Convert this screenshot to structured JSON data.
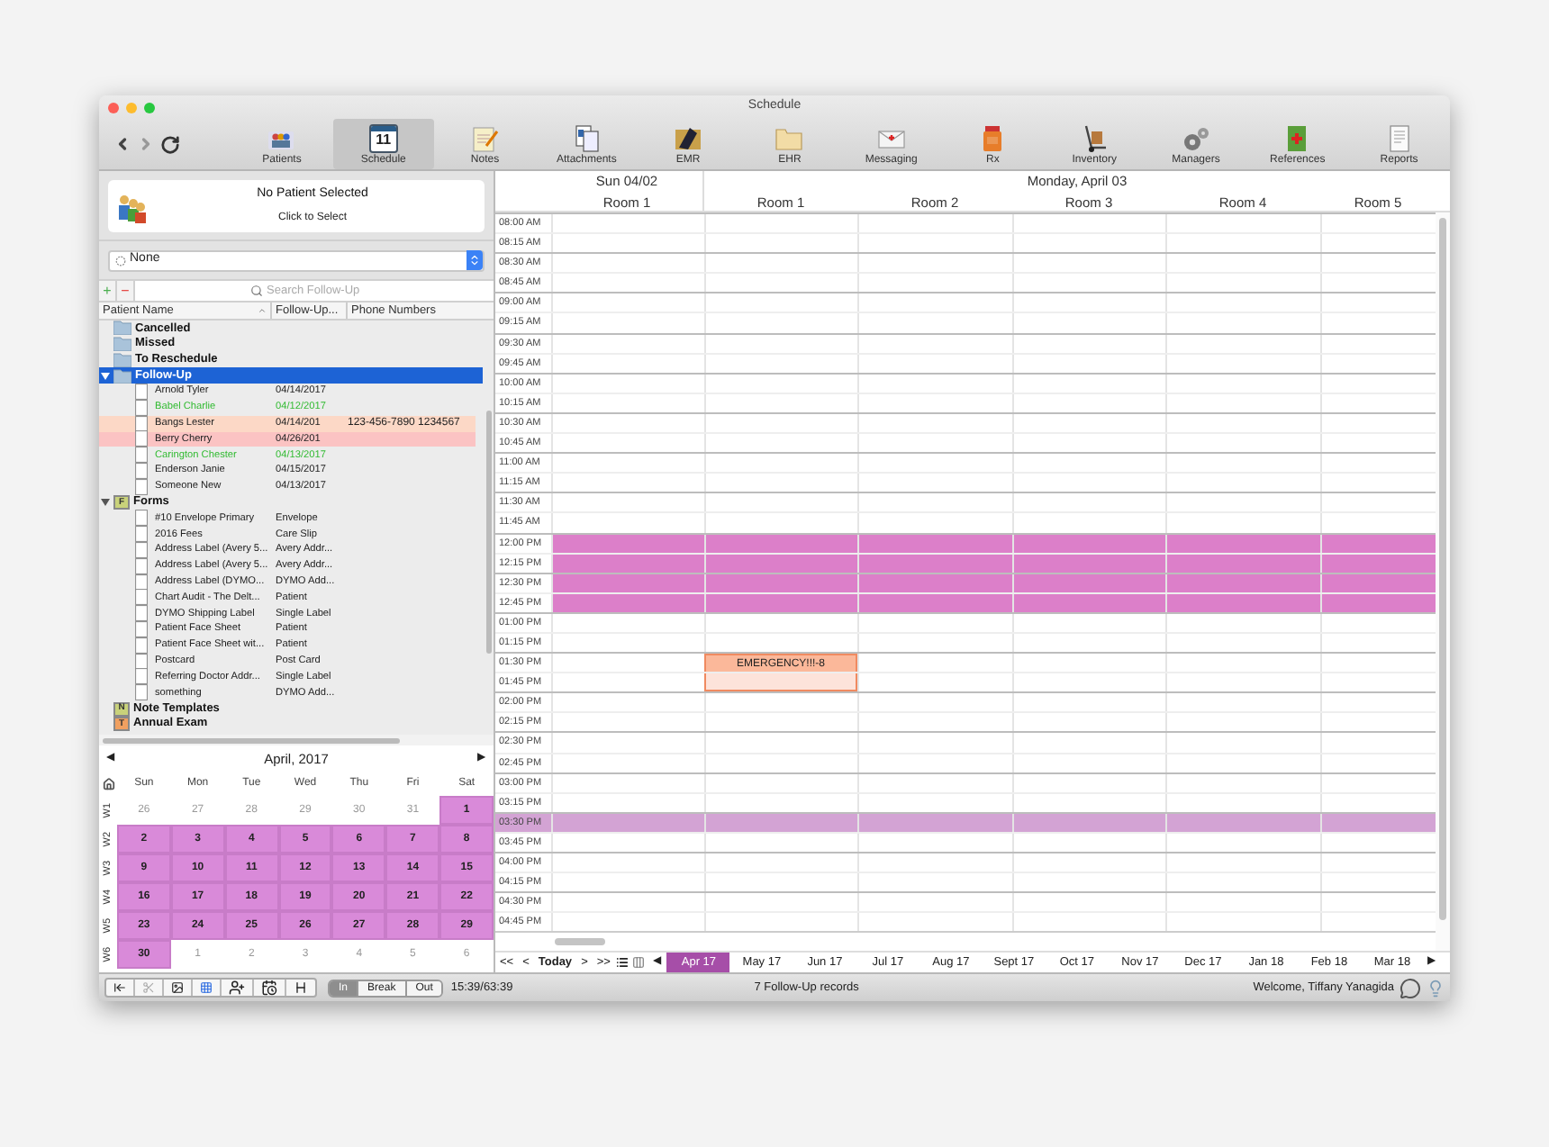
{
  "window": {
    "title": "Schedule"
  },
  "toolbar": {
    "items": [
      {
        "label": "Patients",
        "kind": "patients",
        "selected": false
      },
      {
        "label": "Schedule",
        "kind": "schedule",
        "selected": true,
        "badge": "11"
      },
      {
        "label": "Notes",
        "kind": "notes",
        "selected": false
      },
      {
        "label": "Attachments",
        "kind": "attachments",
        "selected": false
      },
      {
        "label": "EMR",
        "kind": "emr",
        "selected": false
      },
      {
        "label": "EHR",
        "kind": "ehr",
        "selected": false
      },
      {
        "label": "Messaging",
        "kind": "messaging",
        "selected": false
      },
      {
        "label": "Rx",
        "kind": "rx",
        "selected": false
      },
      {
        "label": "Inventory",
        "kind": "inventory",
        "selected": false
      },
      {
        "label": "Managers",
        "kind": "managers",
        "selected": false
      },
      {
        "label": "References",
        "kind": "references",
        "selected": false
      },
      {
        "label": "Reports",
        "kind": "reports",
        "selected": false
      }
    ]
  },
  "patient_card": {
    "title": "No Patient Selected",
    "subtitle": "Click to Select"
  },
  "filter_select": {
    "value": "None"
  },
  "list_toolbar": {
    "add": "+",
    "remove": "−",
    "search_placeholder": "Search Follow-Up"
  },
  "list": {
    "columns": [
      "Patient Name",
      "Follow-Up...",
      "Phone Numbers"
    ],
    "items": [
      {
        "label": "Cancelled",
        "kind": "folder",
        "expanded": false,
        "selected": false
      },
      {
        "label": "Missed",
        "kind": "folder",
        "expanded": false,
        "selected": false
      },
      {
        "label": "To Reschedule",
        "kind": "folder",
        "expanded": false,
        "selected": false
      },
      {
        "label": "Follow-Up",
        "kind": "folder",
        "expanded": true,
        "selected": true,
        "children": [
          {
            "label": "Arnold Tyler",
            "column_2": "04/14/2017",
            "kind": "plain"
          },
          {
            "label": "Babel Charlie",
            "column_2": "04/12/2017",
            "kind": "confirmed"
          },
          {
            "label": "Bangs Lester",
            "column_2": "04/14/201",
            "column_3": "123-456-7890 1234567",
            "kind": "pending"
          },
          {
            "label": "Berry Cherry",
            "column_2": "04/26/201",
            "kind": "overdue"
          },
          {
            "label": "Carington Chester",
            "column_2": "04/13/2017",
            "kind": "confirmed"
          },
          {
            "label": "Enderson Janie",
            "column_2": "04/15/2017",
            "kind": "plain"
          },
          {
            "label": "Someone New",
            "column_2": "04/13/2017",
            "kind": "plain"
          }
        ]
      },
      {
        "label": "Forms",
        "kind": "category",
        "badge": "F",
        "color": "#c9d27a",
        "expanded": true,
        "selected": false,
        "children": [
          {
            "label": "#10 Envelope Primary",
            "column_2": "Envelope",
            "kind": "plain"
          },
          {
            "label": "2016 Fees",
            "column_2": "Care Slip",
            "kind": "plain"
          },
          {
            "label": "Address Label (Avery 5...",
            "column_2": "Avery Addr...",
            "kind": "plain"
          },
          {
            "label": "Address Label (Avery 5...",
            "column_2": "Avery Addr...",
            "kind": "plain"
          },
          {
            "label": "Address Label (DYMO...",
            "column_2": "DYMO Add...",
            "kind": "plain"
          },
          {
            "label": "Chart Audit - The Delt...",
            "column_2": "Patient",
            "kind": "plain"
          },
          {
            "label": "DYMO Shipping Label",
            "column_2": "Single Label",
            "kind": "plain"
          },
          {
            "label": "Patient Face Sheet",
            "column_2": "Patient",
            "kind": "plain"
          },
          {
            "label": "Patient Face Sheet wit...",
            "column_2": "Patient",
            "kind": "plain"
          },
          {
            "label": "Postcard",
            "column_2": "Post Card",
            "kind": "plain"
          },
          {
            "label": "Referring Doctor Addr...",
            "column_2": "Single Label",
            "kind": "plain"
          },
          {
            "label": "something",
            "column_2": "DYMO Add...",
            "kind": "plain"
          }
        ]
      },
      {
        "label": "Note Templates",
        "kind": "category",
        "badge": "N",
        "color": "#c9d27a",
        "expanded": false,
        "selected": false
      },
      {
        "label": "Annual Exam",
        "kind": "category",
        "badge": "T",
        "color": "#f0a060",
        "expanded": false,
        "selected": false
      }
    ]
  },
  "mini_calendar": {
    "prev": "◀",
    "title": "April, 2017",
    "next": "▶",
    "weekdays": [
      "Sun",
      "Mon",
      "Tue",
      "Wed",
      "Thu",
      "Fri",
      "Sat"
    ],
    "weeks": [
      {
        "label": "W1",
        "days": [
          {
            "label": "26",
            "selected": false
          },
          {
            "label": "27",
            "selected": false
          },
          {
            "label": "28",
            "selected": false
          },
          {
            "label": "29",
            "selected": false
          },
          {
            "label": "30",
            "selected": false
          },
          {
            "label": "31",
            "selected": false
          },
          {
            "label": "1",
            "selected": true
          }
        ]
      },
      {
        "label": "W2",
        "days": [
          {
            "label": "2",
            "selected": true
          },
          {
            "label": "3",
            "selected": true
          },
          {
            "label": "4",
            "selected": true
          },
          {
            "label": "5",
            "selected": true
          },
          {
            "label": "6",
            "selected": true
          },
          {
            "label": "7",
            "selected": true
          },
          {
            "label": "8",
            "selected": true
          }
        ]
      },
      {
        "label": "W3",
        "days": [
          {
            "label": "9",
            "selected": true
          },
          {
            "label": "10",
            "selected": true
          },
          {
            "label": "11",
            "selected": true
          },
          {
            "label": "12",
            "selected": true
          },
          {
            "label": "13",
            "selected": true
          },
          {
            "label": "14",
            "selected": true
          },
          {
            "label": "15",
            "selected": true
          }
        ]
      },
      {
        "label": "W4",
        "days": [
          {
            "label": "16",
            "selected": true
          },
          {
            "label": "17",
            "selected": true
          },
          {
            "label": "18",
            "selected": true
          },
          {
            "label": "19",
            "selected": true
          },
          {
            "label": "20",
            "selected": true
          },
          {
            "label": "21",
            "selected": true
          },
          {
            "label": "22",
            "selected": true
          }
        ]
      },
      {
        "label": "W5",
        "days": [
          {
            "label": "23",
            "selected": true
          },
          {
            "label": "24",
            "selected": true
          },
          {
            "label": "25",
            "selected": true
          },
          {
            "label": "26",
            "selected": true
          },
          {
            "label": "27",
            "selected": true
          },
          {
            "label": "28",
            "selected": true
          },
          {
            "label": "29",
            "selected": true
          }
        ]
      },
      {
        "label": "W6",
        "days": [
          {
            "label": "30",
            "selected": true
          },
          {
            "label": "1",
            "selected": false
          },
          {
            "label": "2",
            "selected": false
          },
          {
            "label": "3",
            "selected": false
          },
          {
            "label": "4",
            "selected": false
          },
          {
            "label": "5",
            "selected": false
          },
          {
            "label": "6",
            "selected": false
          }
        ]
      }
    ]
  },
  "schedule": {
    "days": [
      {
        "label": "Sun 04/02",
        "rooms": [
          "Room 1"
        ]
      },
      {
        "label": "Monday, April 03",
        "rooms": [
          "Room 1",
          "Room 2",
          "Room 3",
          "Room 4",
          "Room 5"
        ]
      }
    ],
    "time_slots": [
      {
        "label": "08:00 AM",
        "kind": "open"
      },
      {
        "label": "08:15 AM",
        "kind": "open"
      },
      {
        "label": "08:30 AM",
        "kind": "open"
      },
      {
        "label": "08:45 AM",
        "kind": "open"
      },
      {
        "label": "09:00 AM",
        "kind": "open"
      },
      {
        "label": "09:15 AM",
        "kind": "open"
      },
      {
        "label": "09:30 AM",
        "kind": "open"
      },
      {
        "label": "09:45 AM",
        "kind": "open"
      },
      {
        "label": "10:00 AM",
        "kind": "open"
      },
      {
        "label": "10:15 AM",
        "kind": "open"
      },
      {
        "label": "10:30 AM",
        "kind": "open"
      },
      {
        "label": "10:45 AM",
        "kind": "open"
      },
      {
        "label": "11:00 AM",
        "kind": "open"
      },
      {
        "label": "11:15 AM",
        "kind": "open"
      },
      {
        "label": "11:30 AM",
        "kind": "open"
      },
      {
        "label": "11:45 AM",
        "kind": "open"
      },
      {
        "label": "12:00 PM",
        "kind": "blocked"
      },
      {
        "label": "12:15 PM",
        "kind": "blocked"
      },
      {
        "label": "12:30 PM",
        "kind": "blocked"
      },
      {
        "label": "12:45 PM",
        "kind": "blocked"
      },
      {
        "label": "01:00 PM",
        "kind": "open"
      },
      {
        "label": "01:15 PM",
        "kind": "open"
      },
      {
        "label": "01:30 PM",
        "kind": "open",
        "appointments": [
          {
            "kind": "empty"
          },
          {
            "title": "EMERGENCY!!!-8",
            "kind": "start"
          }
        ]
      },
      {
        "label": "01:45 PM",
        "kind": "open",
        "appointments": [
          {
            "kind": "empty"
          },
          {
            "kind": "body"
          }
        ]
      },
      {
        "label": "02:00 PM",
        "kind": "open"
      },
      {
        "label": "02:15 PM",
        "kind": "open"
      },
      {
        "label": "02:30 PM",
        "kind": "open"
      },
      {
        "label": "02:45 PM",
        "kind": "open"
      },
      {
        "label": "03:00 PM",
        "kind": "open"
      },
      {
        "label": "03:15 PM",
        "kind": "open"
      },
      {
        "label": "03:30 PM",
        "kind": "highlight"
      },
      {
        "label": "03:45 PM",
        "kind": "open"
      },
      {
        "label": "04:00 PM",
        "kind": "open"
      },
      {
        "label": "04:15 PM",
        "kind": "open"
      },
      {
        "label": "04:30 PM",
        "kind": "open"
      },
      {
        "label": "04:45 PM",
        "kind": "open"
      }
    ]
  },
  "month_strip": {
    "nav": [
      "<<",
      "<",
      "Today",
      ">",
      ">>"
    ],
    "prev": "◀",
    "next": "▶",
    "months": [
      {
        "label": "Apr 17",
        "selected": true
      },
      {
        "label": "May 17",
        "selected": false
      },
      {
        "label": "Jun 17",
        "selected": false
      },
      {
        "label": "Jul 17",
        "selected": false
      },
      {
        "label": "Aug 17",
        "selected": false
      },
      {
        "label": "Sept 17",
        "selected": false
      },
      {
        "label": "Oct 17",
        "selected": false
      },
      {
        "label": "Nov 17",
        "selected": false
      },
      {
        "label": "Dec 17",
        "selected": false
      },
      {
        "label": "Jan 18",
        "selected": false
      },
      {
        "label": "Feb 18",
        "selected": false
      },
      {
        "label": "Mar 18",
        "selected": false
      }
    ]
  },
  "status_bar": {
    "clock_segments": [
      {
        "label": "In",
        "selected": true
      },
      {
        "label": "Break",
        "selected": false
      },
      {
        "label": "Out",
        "selected": false
      }
    ],
    "timer": "15:39/63:39",
    "record_count": "7 Follow-Up records",
    "welcome": "Welcome, Tiffany Yanagida"
  }
}
